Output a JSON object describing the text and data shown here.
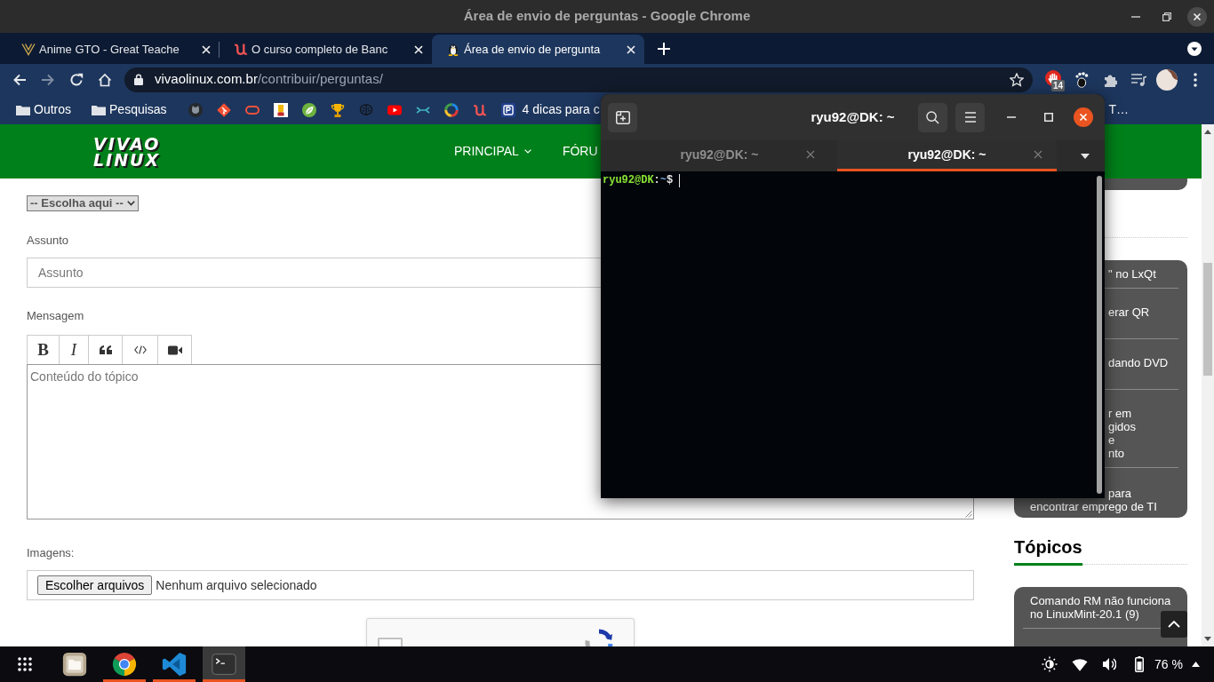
{
  "chrome": {
    "title": "Área de envio de perguntas - Google Chrome",
    "tabs": [
      {
        "title": "Anime GTO - Great Teache",
        "selected": false
      },
      {
        "title": "O curso completo de Banc",
        "selected": false
      },
      {
        "title": "Área de envio de pergunta",
        "selected": true
      }
    ],
    "url": {
      "host": "vivaolinux.com.br",
      "path": "/contribuir/perguntas/"
    },
    "extension_badge": "14",
    "bookmarks": [
      {
        "kind": "folder",
        "label": "Outros"
      },
      {
        "kind": "folder",
        "label": "Pesquisas"
      },
      {
        "kind": "page",
        "label": "4 dicas para c"
      },
      {
        "kind": "fragment",
        "label": "T…"
      }
    ]
  },
  "site": {
    "logo": [
      "VIVAO",
      "LINUX"
    ],
    "nav": [
      {
        "label": "PRINCIPAL",
        "dropdown": true
      },
      {
        "label": "FÓRU"
      }
    ]
  },
  "form": {
    "subcategory": "-- Escolha aqui --",
    "subject": {
      "label": "Assunto",
      "placeholder": "Assunto"
    },
    "message": {
      "label": "Mensagem",
      "placeholder": "Conteúdo do tópico",
      "tools": [
        {
          "kind": "bold",
          "label": "B"
        },
        {
          "kind": "italic",
          "label": "I"
        },
        {
          "kind": "quote"
        },
        {
          "kind": "code"
        },
        {
          "kind": "video"
        }
      ]
    },
    "images": {
      "label": "Imagens:",
      "button": "Escolher arquivos",
      "status": "Nenhum arquivo selecionado"
    },
    "captcha": {
      "checked": false
    }
  },
  "sidebar": {
    "articles": [
      {
        "lines": [
          {
            "text": "\" no LxQt",
            "clipped": true
          }
        ]
      },
      {
        "lines": [
          {
            "text": "erar QR",
            "clipped": true
          }
        ]
      },
      {
        "lines": [
          {
            "text": "dando DVD",
            "clipped": true
          }
        ]
      },
      {
        "lines": [
          {
            "text": "r em",
            "clipped": true
          },
          {
            "text": "gidos",
            "clipped": true
          },
          {
            "text": "e",
            "clipped": true
          },
          {
            "text": "nto",
            "clipped": true
          }
        ]
      },
      {
        "lines": [
          {
            "text": "para",
            "clipped": true
          },
          {
            "text": "encontrar emprego de TI",
            "clipped": false
          }
        ]
      }
    ],
    "topics_title": "Tópicos",
    "topics": [
      {
        "lines": [
          "Comando RM não funciona",
          "no LinuxMint-20.1 (9)"
        ]
      }
    ]
  },
  "terminal": {
    "title": "ryu92@DK: ~",
    "tabs": [
      {
        "title": "ryu92@DK: ~",
        "selected": false
      },
      {
        "title": "ryu92@DK: ~",
        "selected": true
      }
    ],
    "prompt": {
      "user": "ryu92@DK",
      "separator": ":",
      "path": "~",
      "symbol": "$"
    }
  },
  "dock": [
    {
      "running": false,
      "focused": false
    },
    {
      "running": true,
      "focused": false
    },
    {
      "running": true,
      "focused": false
    },
    {
      "running": true,
      "focused": true
    }
  ],
  "tray": {
    "battery": "76 %"
  }
}
